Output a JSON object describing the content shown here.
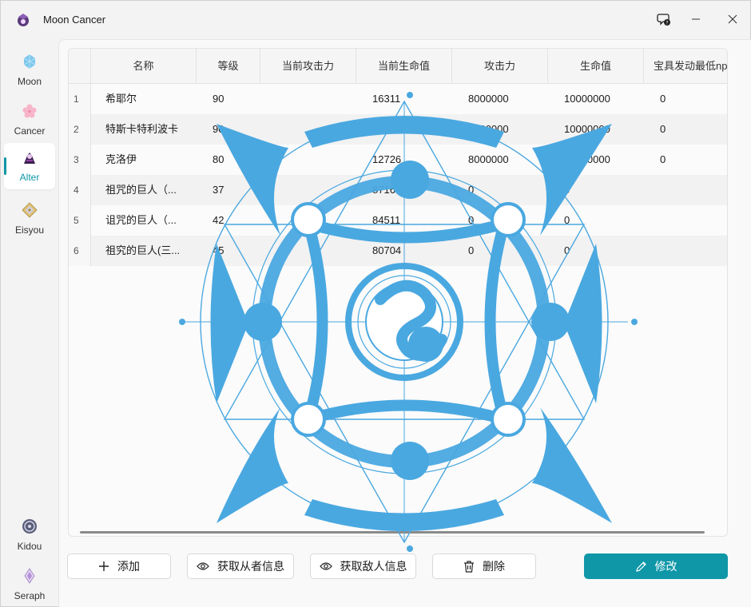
{
  "window": {
    "title": "Moon Cancer",
    "help_icon": "help-icon",
    "minimize_icon": "minimize-icon",
    "close_icon": "close-icon"
  },
  "sidebar": {
    "items": [
      {
        "label": "Moon",
        "icon": "moon-crystal-icon",
        "active": false
      },
      {
        "label": "Cancer",
        "icon": "sakura-icon",
        "active": false
      },
      {
        "label": "Alter",
        "icon": "alter-icon",
        "active": true
      },
      {
        "label": "Eisyou",
        "icon": "eisyou-icon",
        "active": false
      }
    ],
    "bottom_items": [
      {
        "label": "Kidou",
        "icon": "kidou-icon"
      },
      {
        "label": "Seraph",
        "icon": "seraph-icon"
      }
    ]
  },
  "table": {
    "columns": [
      "名称",
      "等级",
      "当前攻击力",
      "当前生命值",
      "攻击力",
      "生命值",
      "宝具发动最低np"
    ],
    "rows": [
      {
        "num": "1",
        "name": "希耶尔",
        "level": "90",
        "cur_atk": "",
        "cur_hp": "16311",
        "atk": "8000000",
        "hp": "10000000",
        "np": "0"
      },
      {
        "num": "2",
        "name": "特斯卡特利波卡",
        "level": "90",
        "cur_atk": "",
        "cur_hp": "16692",
        "atk": "8000000",
        "hp": "10000000",
        "np": "0"
      },
      {
        "num": "3",
        "name": "克洛伊",
        "level": "80",
        "cur_atk": "",
        "cur_hp": "12726",
        "atk": "8000000",
        "hp": "10000000",
        "np": "0"
      },
      {
        "num": "4",
        "name": "祖咒的巨人（...",
        "level": "37",
        "cur_atk": "",
        "cur_hp": "87163",
        "atk": "0",
        "hp": "0",
        "np": ""
      },
      {
        "num": "5",
        "name": "诅咒的巨人（...",
        "level": "42",
        "cur_atk": "",
        "cur_hp": "84511",
        "atk": "0",
        "hp": "0",
        "np": ""
      },
      {
        "num": "6",
        "name": "祖究的巨人(三...",
        "level": "45",
        "cur_atk": "",
        "cur_hp": "80704",
        "atk": "0",
        "hp": "0",
        "np": ""
      }
    ]
  },
  "buttons": {
    "add": "添加",
    "get_servant": "获取从者信息",
    "get_enemy": "获取敌人信息",
    "delete": "删除",
    "edit": "修改"
  },
  "colors": {
    "accent": "#0f97a8",
    "magic_circle": "#4aa8e0"
  }
}
